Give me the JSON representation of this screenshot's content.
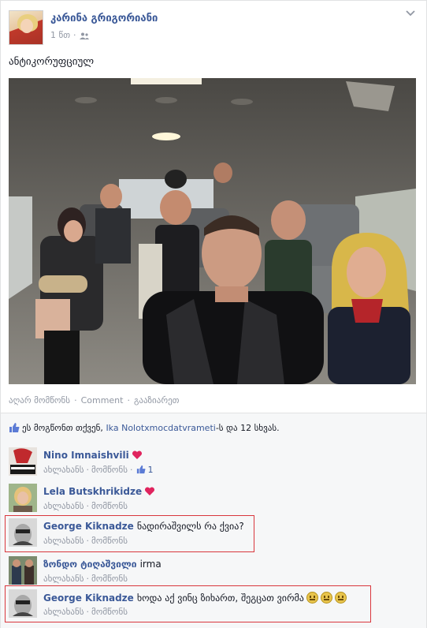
{
  "post": {
    "author": "კარინა გრიგორიანი",
    "time": "1 წთ",
    "text": "ანტიკორუფციულ",
    "actions": {
      "like": "აღარ მომწონს",
      "comment": "Comment",
      "share": "გააზიარეთ"
    },
    "likes_summary": {
      "prefix": "ეს მოგწონთ თქვენ, ",
      "name": "Ika Nolotxmocdatvrameti",
      "suffix": "-ს და 12 სხვას."
    }
  },
  "comments": [
    {
      "name": "Nino Imnaishvili",
      "text": "",
      "reply": "ახლახანს",
      "like": "მომწონს",
      "likes": "1",
      "heart": true
    },
    {
      "name": "Lela Butskhrikidze",
      "text": "",
      "reply": "ახლახანს",
      "like": "მომწონს",
      "likes": "",
      "heart": true
    },
    {
      "name": "George Kiknadze",
      "text": "ნადირაშვილს რა ქვია?",
      "reply": "ახლახანს",
      "like": "მომწონს",
      "likes": "",
      "heart": false
    },
    {
      "name": "ზონდო ტიღაშვილი",
      "text": "irma",
      "reply": "ახლახანს",
      "like": "მომწონს",
      "likes": "",
      "heart": false
    },
    {
      "name": "George Kiknadze",
      "text": "ხოდა აქ ვინც ზიხართ, შეგცათ ვირმა",
      "reply": "ახლახანს",
      "like": "მომწონს",
      "likes": "",
      "heart": false
    }
  ],
  "colors": {
    "link": "#3b5998",
    "meta": "#9197a3",
    "highlight": "#d9373d",
    "heart": "#e0245e"
  },
  "icons": [
    "friends-icon",
    "chevron-down-icon",
    "like-thumb-icon",
    "heart-icon",
    "smiley-icon"
  ]
}
